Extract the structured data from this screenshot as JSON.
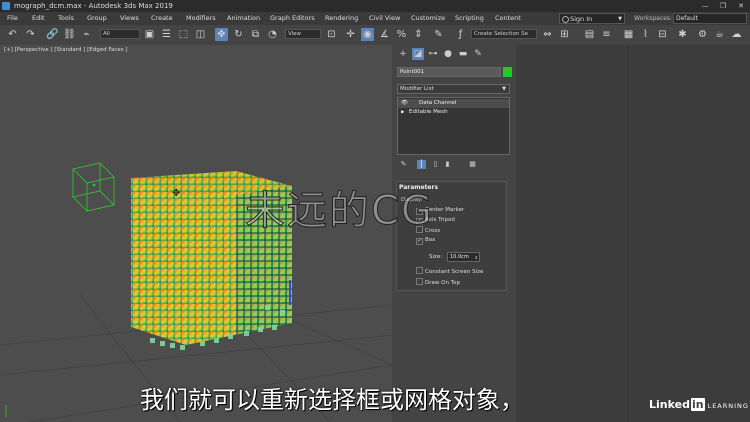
{
  "window": {
    "title": "mograph_dcm.max - Autodesk 3ds Max 2019",
    "min": "—",
    "max": "❐",
    "close": "✕"
  },
  "menu": {
    "items": [
      "File",
      "Edit",
      "Tools",
      "Group",
      "Views",
      "Create",
      "Modifiers",
      "Animation",
      "Graph Editors",
      "Rendering",
      "Civil View",
      "Customize",
      "Scripting",
      "Content"
    ],
    "sign_in": "Sign In",
    "workspaces_label": "Workspaces:",
    "workspace_value": "Default"
  },
  "toolbar": {
    "filter_value": "All",
    "refcoord_value": "View",
    "selection_set_placeholder": "Create Selection Se"
  },
  "viewport": {
    "label": "[+] [Perspective ] [Standard ] [Edged Faces ]"
  },
  "command_panel": {
    "object_name": "Point001",
    "object_color": "#22cc22",
    "modifier_list": "Modifier List",
    "stack": [
      "Data Channel",
      "Editable Mesh"
    ],
    "parameters": {
      "title": "Parameters",
      "display_label": "Display:",
      "options": [
        {
          "label": "Center Marker",
          "checked": true
        },
        {
          "label": "Axis Tripod",
          "checked": true
        },
        {
          "label": "Cross",
          "checked": false
        },
        {
          "label": "Box",
          "checked": true
        }
      ],
      "size_label": "Size:",
      "size_value": "10.0cm",
      "constant_screen_size": "Constant Screen Size",
      "draw_on_top": "Draw On Top"
    }
  },
  "overlay": {
    "watermark": "未远的CG",
    "subtitle": "我们就可以重新选择框或网格对象，",
    "brand": "Linked",
    "brand_in": "in",
    "brand_learning": "LEARNING"
  }
}
